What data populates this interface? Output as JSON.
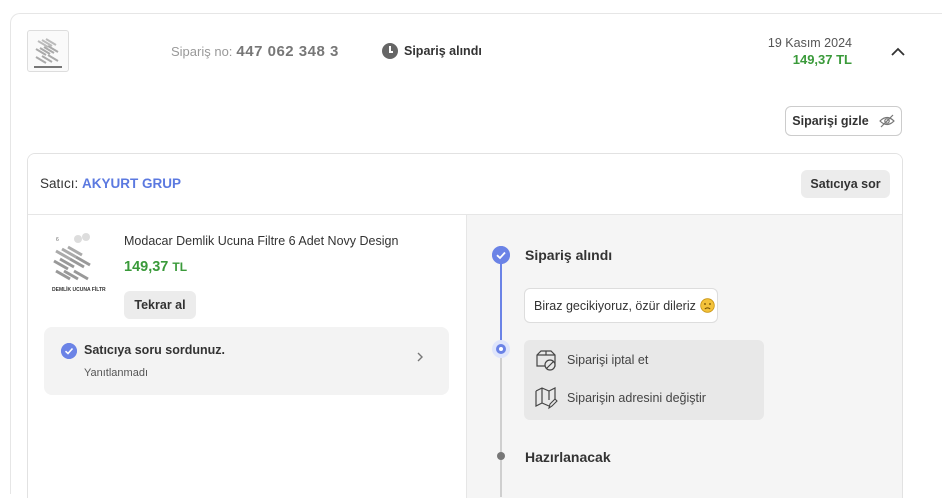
{
  "order": {
    "no_label": "Sipariş no:",
    "no_value": "447 062 348 3",
    "status": "Sipariş alındı",
    "date": "19 Kasım 2024",
    "total": "149,37 TL",
    "hide_label": "Siparişi gizle"
  },
  "seller": {
    "label": "Satıcı:",
    "name": "AKYURT GRUP",
    "ask_label": "Satıcıya sor"
  },
  "product": {
    "name": "Modacar Demlik Ucuna Filtre 6 Adet Novy Design",
    "price": "149,37",
    "currency": "TL",
    "reorder_label": "Tekrar al"
  },
  "question": {
    "title": "Satıcıya soru sordunuz.",
    "status": "Yanıtlanmadı"
  },
  "timeline": {
    "step1": "Sipariş alındı",
    "delay_message": "Biraz gecikiyoruz, özür dileriz",
    "cancel_label": "Siparişi iptal et",
    "change_address_label": "Siparişin adresini değiştir",
    "step2": "Hazırlanacak"
  },
  "colors": {
    "accent": "#6b83e6",
    "price": "#3a9a3a",
    "seller": "#5b79e0"
  }
}
